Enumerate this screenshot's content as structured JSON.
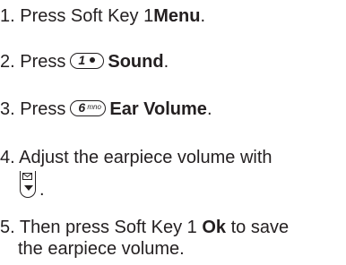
{
  "steps": [
    {
      "num": "1.",
      "text1": "Press  Soft Key 1",
      "bold": "Menu",
      "text2": "."
    },
    {
      "num": "2.",
      "text1": "Press",
      "key_icon": "key-1-icon",
      "bold": "Sound",
      "text2": "."
    },
    {
      "num": "3.",
      "text1": "Press",
      "key_icon": "key-6-mno-icon",
      "bold": "Ear Volume",
      "text2": "."
    },
    {
      "num": "4.",
      "text1": "Adjust the earpiece volume with",
      "key_icon": "navigation-key-down-icon",
      "text2": "."
    },
    {
      "num": "5.",
      "text1": "Then press Soft Key 1",
      "bold": "Ok",
      "text2": "to save",
      "line2": "the earpiece volume."
    }
  ],
  "keys": {
    "key1_digit": "1",
    "key6_digit": "6",
    "key6_letters": "mno"
  }
}
